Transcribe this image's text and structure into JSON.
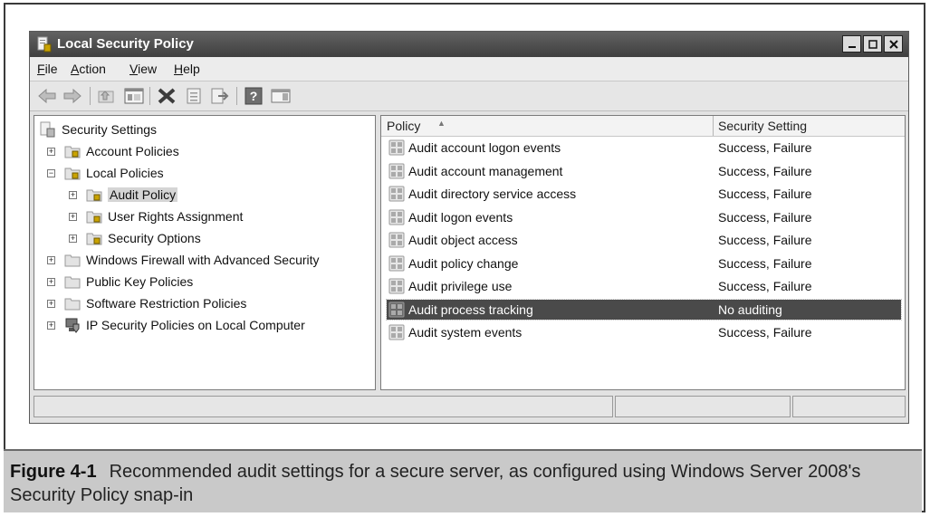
{
  "window": {
    "title": "Local Security Policy"
  },
  "menu": [
    {
      "label": "File",
      "hotkey": "F",
      "rest": "ile"
    },
    {
      "label": "Action",
      "hotkey": "A",
      "rest": "ction"
    },
    {
      "label": "View",
      "hotkey": "V",
      "rest": "iew"
    },
    {
      "label": "Help",
      "hotkey": "H",
      "rest": "elp"
    }
  ],
  "toolbar": {
    "icons": [
      "back-icon",
      "forward-icon",
      "up-folder-icon",
      "show-hide-tree-icon",
      "delete-icon",
      "properties-icon",
      "export-list-icon",
      "help-icon",
      "action-pane-icon"
    ]
  },
  "tree": {
    "root": "Security Settings",
    "items": [
      {
        "label": "Account Policies",
        "expander": "+"
      },
      {
        "label": "Local Policies",
        "expander": "−"
      },
      {
        "label": "Audit Policy",
        "expander": "+"
      },
      {
        "label": "User Rights Assignment",
        "expander": "+"
      },
      {
        "label": "Security Options",
        "expander": "+"
      },
      {
        "label": "Windows Firewall with Advanced Security",
        "expander": "+"
      },
      {
        "label": "Public Key Policies",
        "expander": "+"
      },
      {
        "label": "Software Restriction Policies",
        "expander": "+"
      },
      {
        "label": "IP Security Policies on Local Computer",
        "expander": "+"
      }
    ]
  },
  "list": {
    "columns": [
      "Policy",
      "Security Setting"
    ],
    "rows": [
      {
        "policy": "Audit account logon events",
        "setting": "Success, Failure"
      },
      {
        "policy": "Audit account management",
        "setting": "Success, Failure"
      },
      {
        "policy": "Audit directory service access",
        "setting": "Success, Failure"
      },
      {
        "policy": "Audit logon events",
        "setting": "Success, Failure"
      },
      {
        "policy": "Audit object access",
        "setting": "Success, Failure"
      },
      {
        "policy": "Audit policy change",
        "setting": "Success, Failure"
      },
      {
        "policy": "Audit privilege use",
        "setting": "Success, Failure"
      },
      {
        "policy": "Audit process tracking",
        "setting": "No auditing"
      },
      {
        "policy": "Audit system events",
        "setting": "Success, Failure"
      }
    ]
  },
  "caption": {
    "label": "Figure 4-1",
    "text": "Recommended audit settings for a secure server, as configured using Windows Server 2008's Security Policy snap-in"
  },
  "colors": {
    "titlebar": "#4f4f4f",
    "selection": "#4a4a4a",
    "caption_bg": "#c9c9c9"
  }
}
